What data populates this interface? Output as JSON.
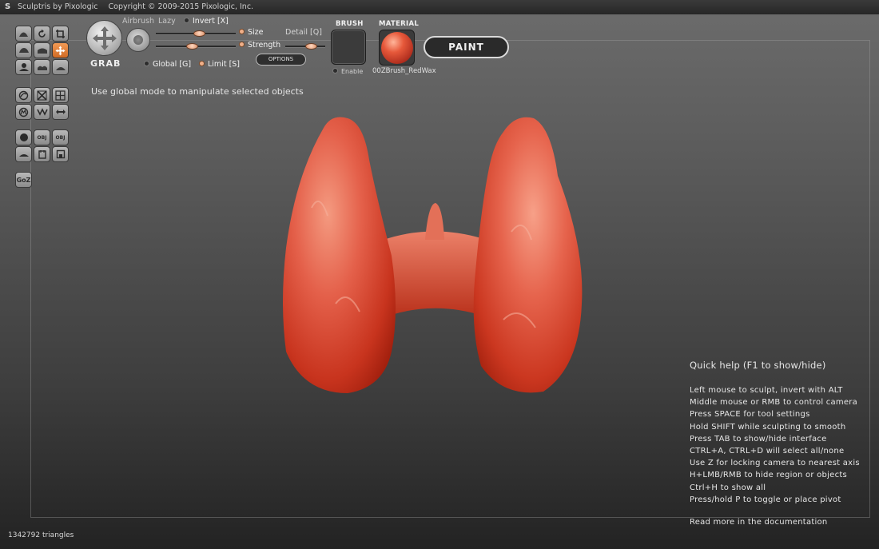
{
  "window": {
    "title": "Sculptris by Pixologic",
    "copyright": "Copyright © 2009-2015 Pixologic, Inc."
  },
  "left_toolbar": {
    "group1": [
      "draw-icon",
      "rotate-icon",
      "crop-icon",
      "flatten-icon",
      "inflate-icon",
      "grab-icon",
      "pinch-icon",
      "crease-icon",
      "smooth-icon"
    ],
    "group2": [
      "reduce-icon",
      "mask-icon",
      "symmetry-icon",
      "wireframe-icon",
      "tiles-icon",
      "mirror-icon"
    ],
    "group3": [
      "sphere-icon",
      "import-obj-icon",
      "export-obj-icon",
      "plane-icon",
      "new-icon",
      "save-icon"
    ],
    "obj_label": "OBJ",
    "goz_label": "GoZ",
    "active_icon": "grab-icon"
  },
  "tool": {
    "name": "GRAB",
    "airbrush_label": "Airbrush",
    "lazy_label": "Lazy",
    "invert_label": "Invert [X]",
    "size_label": "Size",
    "strength_label": "Strength",
    "detail_label": "Detail [Q]",
    "global_label": "Global [G]",
    "limit_label": "Limit [S]",
    "options_label": "OPTIONS",
    "size_value": 0.55,
    "strength_value": 0.45,
    "detail_value": 0.7,
    "invert_checked": false,
    "global_checked": false,
    "limit_checked": true
  },
  "brush": {
    "title": "BRUSH",
    "enable_label": "Enable"
  },
  "material": {
    "title": "MATERIAL",
    "name": "00ZBrush_RedWax",
    "color": "#e6583a"
  },
  "paint_button": {
    "label": "PAINT"
  },
  "hint": "Use global mode to manipulate selected objects",
  "quick_help": {
    "title": "Quick help (F1 to show/hide)",
    "lines": [
      "Left mouse to sculpt, invert with ALT",
      "Middle mouse or RMB to control camera",
      "Press SPACE for tool settings",
      "Hold SHIFT while sculpting to smooth",
      "Press TAB to show/hide interface",
      "CTRL+A, CTRL+D will select all/none",
      "Use Z for locking camera to nearest axis",
      "H+LMB/RMB to hide region or objects",
      "Ctrl+H to show all",
      "Press/hold P to toggle or place pivot"
    ],
    "more": "Read more in the documentation"
  },
  "status": {
    "triangles": "1342792 triangles"
  }
}
